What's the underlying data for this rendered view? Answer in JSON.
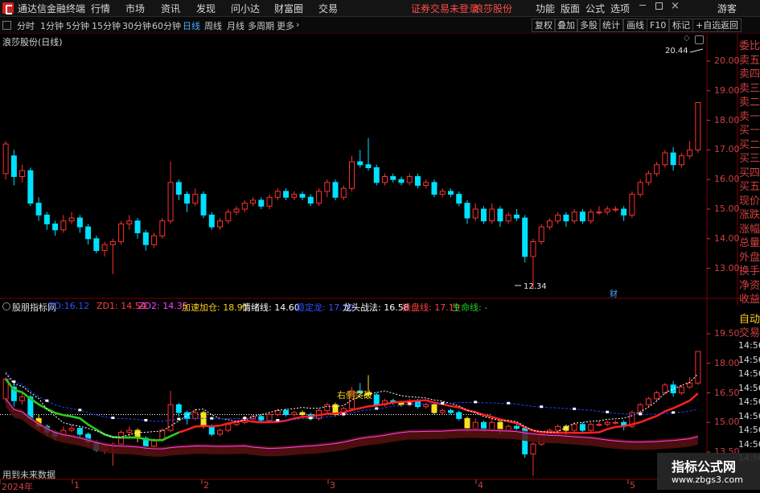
{
  "titlebar": {
    "app_title": "通达信金融终端",
    "menus": [
      "行情",
      "市场",
      "资讯",
      "发现",
      "问小达",
      "财富圈",
      "交易"
    ],
    "notice": "证券交易未登录",
    "stock_name": "浪莎股份",
    "right": [
      "功能",
      "版面",
      "公式",
      "选项"
    ],
    "guest": "游客"
  },
  "periods": [
    "分时",
    "1分钟",
    "5分钟",
    "15分钟",
    "30分钟",
    "60分钟",
    "日线",
    "周线",
    "月线",
    "多周期",
    "更多"
  ],
  "active_period": "日线",
  "toolbar": [
    "复权",
    "叠加",
    "多股",
    "统计",
    "画线",
    "F10",
    "标记",
    "+自选",
    "返回"
  ],
  "main_chart": {
    "title": "浪莎股份(日线)",
    "y_ticks": [
      "20.00",
      "19.00",
      "18.00",
      "17.00",
      "16.00",
      "15.00",
      "14.00",
      "13.00"
    ],
    "high_label": "20.44",
    "low_label": "12.34",
    "finance_marker": "财"
  },
  "side_panel": [
    "委比",
    "卖五",
    "卖四",
    "卖三",
    "卖二",
    "卖一",
    "买一",
    "买二",
    "买三",
    "买四",
    "买五",
    "现价",
    "涨跌",
    "涨幅",
    "总量",
    "外盘",
    "换手",
    "净资",
    "收益"
  ],
  "sub_chart": {
    "name": "股朋指标网",
    "legend": [
      {
        "text": "ZD:16.12",
        "color": "#3050ff"
      },
      {
        "text": "ZD1: 14.54",
        "color": "#ff4040"
      },
      {
        "text": "ZD2: 14.35",
        "color": "#ff40ff"
      },
      {
        "text": "加速加仓: 18.91",
        "color": "#ffd020"
      },
      {
        "text": "情绪线: 14.60",
        "color": "#ffffff"
      },
      {
        "text": "稳定龙: 17.10",
        "color": "#3050ff"
      },
      {
        "text": "龙头战法: 16.58",
        "color": "#ffffff"
      },
      {
        "text": "操盘线: 17.19",
        "color": "#ff4040"
      },
      {
        "text": "生命线: -",
        "color": "#20d020"
      }
    ],
    "annotation": "右侧突破",
    "y_ticks": [
      "19.50",
      "18.00",
      "16.50",
      "15.00",
      "13.50"
    ],
    "side_labels": [
      "自动",
      "交易"
    ],
    "time_labels": [
      "14:56",
      "14:56",
      "14:56",
      "14:56",
      "14:56",
      "14:56",
      "14:56",
      "14:56",
      "14:56"
    ],
    "future_note": "用到未来数据"
  },
  "date_axis": {
    "labels": [
      "2024年",
      "1",
      "2",
      "3",
      "4",
      "5"
    ]
  },
  "watermark": {
    "line1": "指标公式网",
    "line2": "www.zbgs3.com"
  },
  "chart_data": {
    "type": "candlestick",
    "title": "浪莎股份(日线)",
    "ylim": [
      12.0,
      21.0
    ],
    "ohlc": [
      [
        16.2,
        17.2,
        17.3,
        16.0
      ],
      [
        16.8,
        16.1,
        17.0,
        15.8
      ],
      [
        16.1,
        16.3,
        16.5,
        15.9
      ],
      [
        16.3,
        15.2,
        16.4,
        15.1
      ],
      [
        15.2,
        14.8,
        15.4,
        14.6
      ],
      [
        14.8,
        14.5,
        14.9,
        14.3
      ],
      [
        14.5,
        14.3,
        14.6,
        14.1
      ],
      [
        14.3,
        14.6,
        14.8,
        14.2
      ],
      [
        14.6,
        14.7,
        14.9,
        14.5
      ],
      [
        14.7,
        14.4,
        14.8,
        14.2
      ],
      [
        14.4,
        14.0,
        14.5,
        13.8
      ],
      [
        14.0,
        13.6,
        14.1,
        13.5
      ],
      [
        13.6,
        13.8,
        13.9,
        13.4
      ],
      [
        13.8,
        13.9,
        14.0,
        12.8
      ],
      [
        13.9,
        14.5,
        14.6,
        13.8
      ],
      [
        14.5,
        14.6,
        14.8,
        14.3
      ],
      [
        14.6,
        14.2,
        14.7,
        14.0
      ],
      [
        14.2,
        13.8,
        14.3,
        13.6
      ],
      [
        13.8,
        14.1,
        14.2,
        13.7
      ],
      [
        14.1,
        14.6,
        14.7,
        14.0
      ],
      [
        14.6,
        15.9,
        16.6,
        14.5
      ],
      [
        15.9,
        15.5,
        16.0,
        15.3
      ],
      [
        15.5,
        15.2,
        15.6,
        14.9
      ],
      [
        15.2,
        15.5,
        15.7,
        15.1
      ],
      [
        15.5,
        14.8,
        15.6,
        14.7
      ],
      [
        14.8,
        14.4,
        14.9,
        14.3
      ],
      [
        14.4,
        14.6,
        14.7,
        14.3
      ],
      [
        14.6,
        14.9,
        15.0,
        14.5
      ],
      [
        14.9,
        15.0,
        15.1,
        14.8
      ],
      [
        15.0,
        15.2,
        15.3,
        14.9
      ],
      [
        15.2,
        15.3,
        15.4,
        15.1
      ],
      [
        15.3,
        15.1,
        15.4,
        15.0
      ],
      [
        15.1,
        15.4,
        15.5,
        15.0
      ],
      [
        15.4,
        15.6,
        15.7,
        15.3
      ],
      [
        15.6,
        15.4,
        15.7,
        15.3
      ],
      [
        15.4,
        15.5,
        15.6,
        15.3
      ],
      [
        15.5,
        15.4,
        15.6,
        15.3
      ],
      [
        15.4,
        15.2,
        15.5,
        15.1
      ],
      [
        15.2,
        15.6,
        15.7,
        15.1
      ],
      [
        15.6,
        15.9,
        16.0,
        15.4
      ],
      [
        15.9,
        15.4,
        16.0,
        15.3
      ],
      [
        15.4,
        15.7,
        15.8,
        15.3
      ],
      [
        15.7,
        16.6,
        16.8,
        15.6
      ],
      [
        16.6,
        16.5,
        17.0,
        16.4
      ],
      [
        16.5,
        16.4,
        17.4,
        16.3
      ],
      [
        16.4,
        15.9,
        16.5,
        15.8
      ],
      [
        15.9,
        16.1,
        16.2,
        15.8
      ],
      [
        16.1,
        16.0,
        16.2,
        15.9
      ],
      [
        16.0,
        15.9,
        16.1,
        15.8
      ],
      [
        15.9,
        16.1,
        16.2,
        15.8
      ],
      [
        16.1,
        15.8,
        16.2,
        15.7
      ],
      [
        15.8,
        15.9,
        16.0,
        15.7
      ],
      [
        15.9,
        15.5,
        16.0,
        15.4
      ],
      [
        15.5,
        15.6,
        15.7,
        15.4
      ],
      [
        15.6,
        15.5,
        15.7,
        15.4
      ],
      [
        15.5,
        15.2,
        15.6,
        15.1
      ],
      [
        15.2,
        14.7,
        15.3,
        14.5
      ],
      [
        14.7,
        15.0,
        15.2,
        14.6
      ],
      [
        15.0,
        14.6,
        15.1,
        14.5
      ],
      [
        14.6,
        15.0,
        15.2,
        14.5
      ],
      [
        15.0,
        14.6,
        15.1,
        14.4
      ],
      [
        14.6,
        14.8,
        14.9,
        14.5
      ],
      [
        14.8,
        14.7,
        15.0,
        14.6
      ],
      [
        14.7,
        13.4,
        14.8,
        13.2
      ],
      [
        13.4,
        13.9,
        14.0,
        12.3
      ],
      [
        13.9,
        14.4,
        14.5,
        13.8
      ],
      [
        14.4,
        14.6,
        14.7,
        14.3
      ],
      [
        14.6,
        14.8,
        14.9,
        14.5
      ],
      [
        14.8,
        14.6,
        14.9,
        14.4
      ],
      [
        14.6,
        14.9,
        15.0,
        14.5
      ],
      [
        14.9,
        14.6,
        15.0,
        14.5
      ],
      [
        14.6,
        14.9,
        15.0,
        14.5
      ],
      [
        14.9,
        14.9,
        15.1,
        14.8
      ],
      [
        14.9,
        15.0,
        15.1,
        14.8
      ],
      [
        15.0,
        15.0,
        15.1,
        14.9
      ],
      [
        15.0,
        14.8,
        15.1,
        14.6
      ],
      [
        14.8,
        15.5,
        15.6,
        14.7
      ],
      [
        15.5,
        15.9,
        16.0,
        15.4
      ],
      [
        15.9,
        16.2,
        16.3,
        15.8
      ],
      [
        16.2,
        16.5,
        16.6,
        16.1
      ],
      [
        16.5,
        16.9,
        17.0,
        16.4
      ],
      [
        16.9,
        16.5,
        17.1,
        16.3
      ],
      [
        16.5,
        16.8,
        16.9,
        16.4
      ],
      [
        16.8,
        17.0,
        17.3,
        16.7
      ],
      [
        17.0,
        18.6,
        18.6,
        16.9
      ]
    ]
  }
}
